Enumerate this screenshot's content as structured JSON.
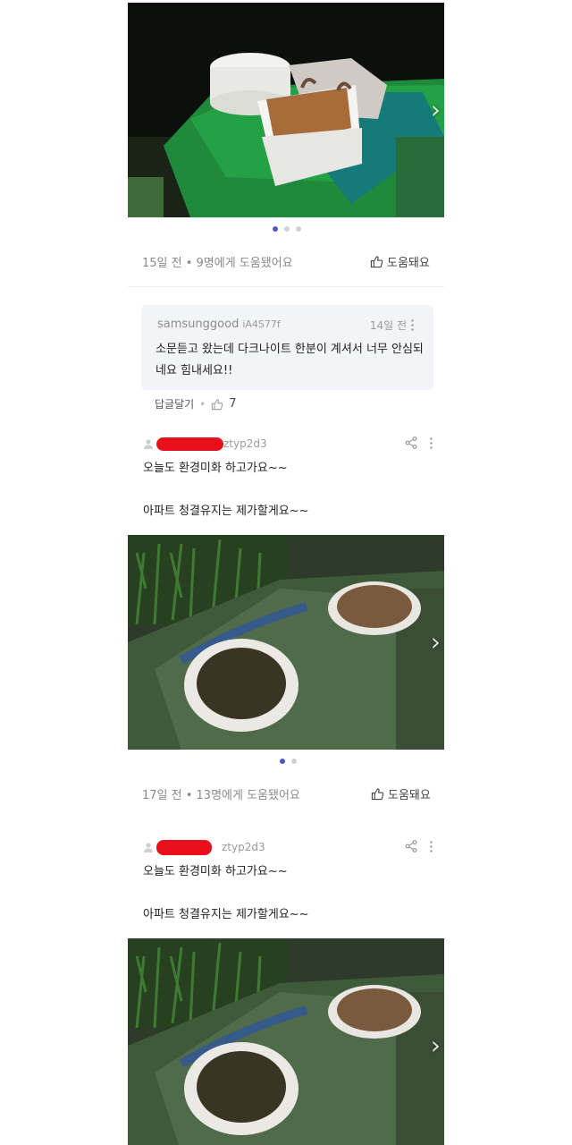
{
  "post1": {
    "meta": "15일 전 • 9명에게 도움됐어요",
    "helpful_label": "도움돼요"
  },
  "reply": {
    "username": "samsunggood",
    "user_id": "iA4S77f",
    "time": "14일 전",
    "text": "소문듣고 왔는데 다크나이트 한분이 계셔서 너무 안심되네요 힘내세요!!",
    "reply_label": "답글달기",
    "like_count": "7"
  },
  "post2": {
    "user_id": "ztyp2d3",
    "line1": "오늘도 환경미화 하고가요~~",
    "line2": "아파트 청결유지는 제가할게요~~",
    "meta": "17일 전 • 13명에게 도움됐어요",
    "helpful_label": "도움돼요"
  },
  "post3": {
    "user_id": "ztyp2d3",
    "line1": "오늘도 환경미화 하고가요~~",
    "line2": "아파트 청결유지는 제가할게요~~"
  },
  "icons": {
    "next": "chevron-right-icon",
    "thumb": "thumbs-up-icon",
    "share": "share-icon",
    "more": "more-vertical-icon"
  },
  "colors": {
    "accent": "#4a5bc4",
    "redaction": "#e8101a",
    "reply_bg": "#f3f4f7"
  },
  "carousel": {
    "photo1_pages": 3,
    "photo2_pages": 2
  }
}
